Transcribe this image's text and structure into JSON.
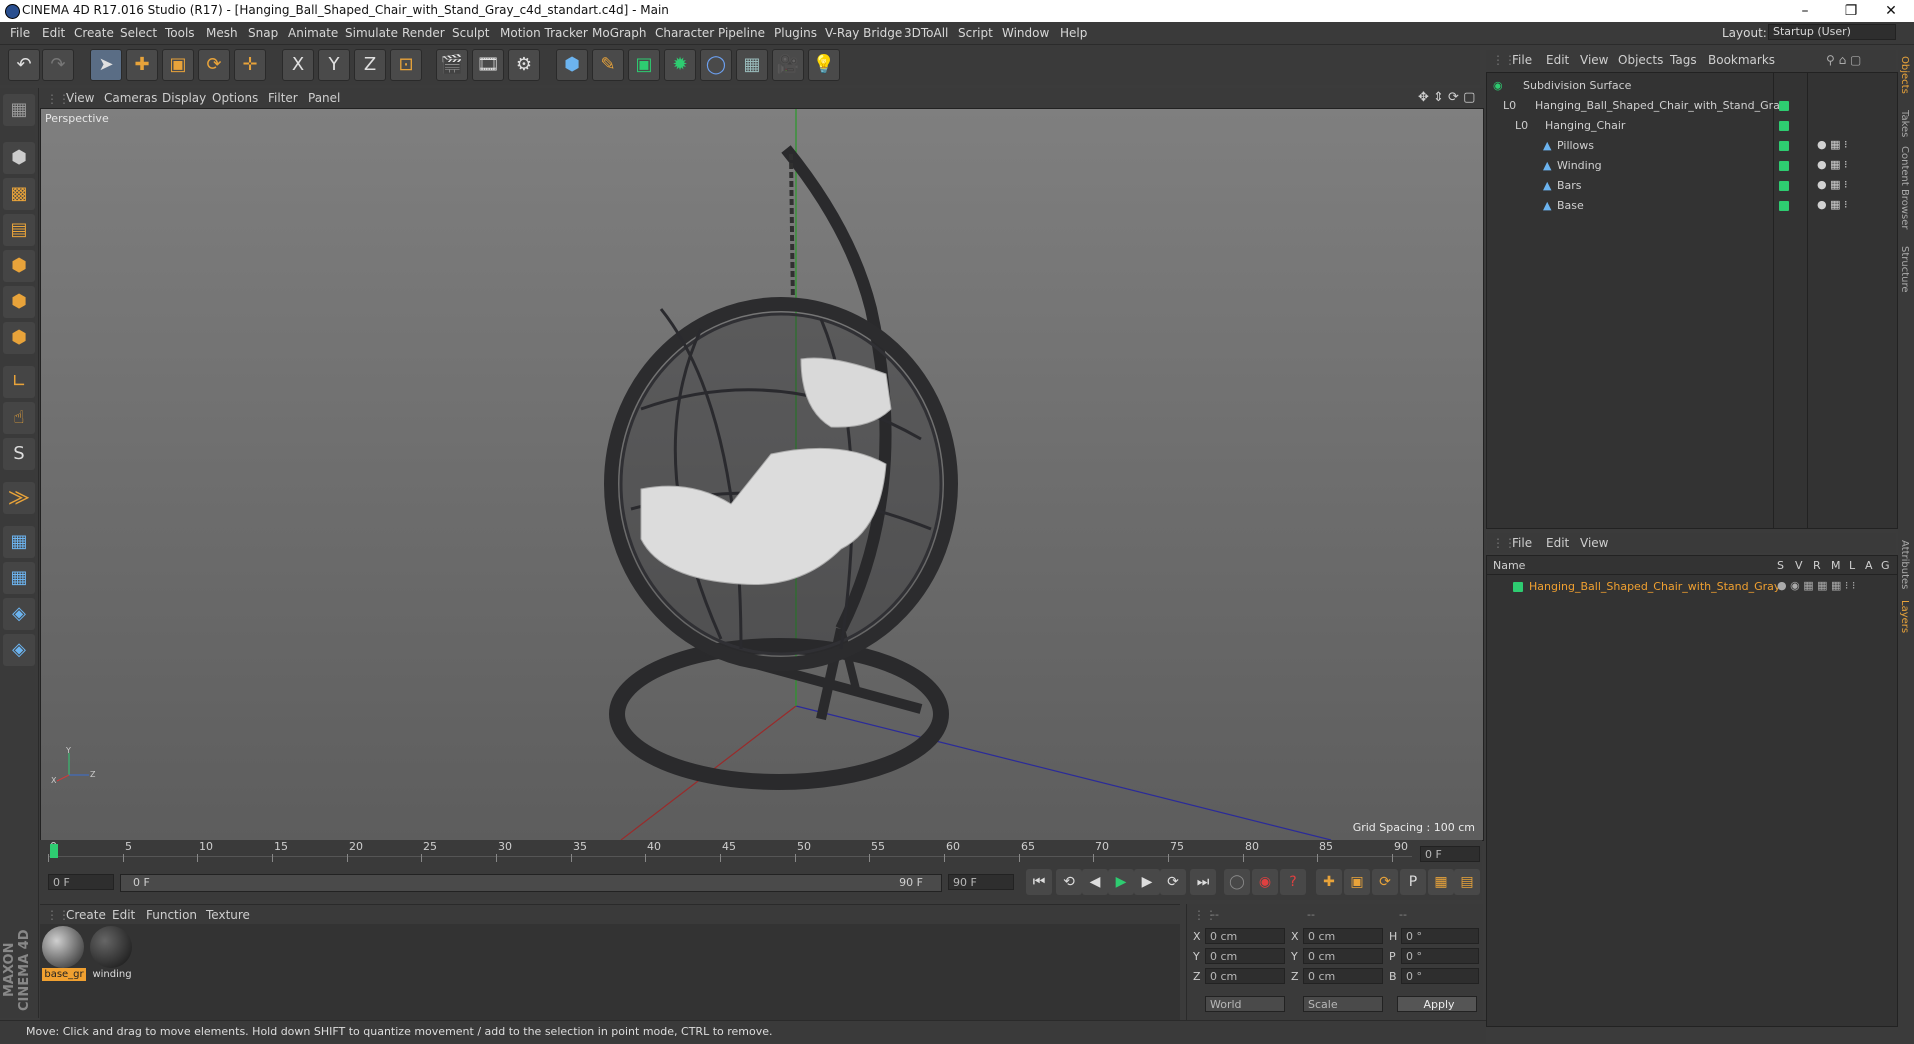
{
  "window": {
    "title": "CINEMA 4D R17.016 Studio (R17) - [Hanging_Ball_Shaped_Chair_with_Stand_Gray_c4d_standart.c4d] - Main"
  },
  "menubar": [
    "File",
    "Edit",
    "Create",
    "Select",
    "Tools",
    "Mesh",
    "Snap",
    "Animate",
    "Simulate",
    "Render",
    "Sculpt",
    "Motion Tracker",
    "MoGraph",
    "Character",
    "Pipeline",
    "Plugins",
    "V-Ray Bridge",
    "3DToAll",
    "Script",
    "Window",
    "Help"
  ],
  "layout": {
    "label": "Layout:",
    "value": "Startup (User)"
  },
  "viewport": {
    "menu": [
      "View",
      "Cameras",
      "Display",
      "Options",
      "Filter",
      "Panel"
    ],
    "label": "Perspective",
    "grid_spacing": "Grid Spacing : 100 cm"
  },
  "timeline": {
    "ticks": [
      "0",
      "5",
      "10",
      "15",
      "20",
      "25",
      "30",
      "35",
      "40",
      "45",
      "50",
      "55",
      "60",
      "65",
      "70",
      "75",
      "80",
      "85",
      "90"
    ],
    "current_frame": "0 F",
    "start": "0 F",
    "range_start": "0 F",
    "range_end": "90 F",
    "end": "90 F"
  },
  "materials": {
    "menu": [
      "Create",
      "Edit",
      "Function",
      "Texture"
    ],
    "items": [
      {
        "name": "base_gr"
      },
      {
        "name": "winding"
      }
    ]
  },
  "coords": {
    "header": [
      "--",
      "--",
      "--"
    ],
    "rows": [
      {
        "a": "X",
        "av": "0 cm",
        "b": "X",
        "bv": "0 cm",
        "c": "H",
        "cv": "0 °"
      },
      {
        "a": "Y",
        "av": "0 cm",
        "b": "Y",
        "bv": "0 cm",
        "c": "P",
        "cv": "0 °"
      },
      {
        "a": "Z",
        "av": "0 cm",
        "b": "Z",
        "bv": "0 cm",
        "c": "B",
        "cv": "0 °"
      }
    ],
    "mode": "World",
    "scale": "Scale",
    "apply": "Apply"
  },
  "objects": {
    "menu": [
      "File",
      "Edit",
      "View",
      "Objects",
      "Tags",
      "Bookmarks"
    ],
    "tree": [
      {
        "name": "Subdivision Surface",
        "level": 0
      },
      {
        "name": "Hanging_Ball_Shaped_Chair_with_Stand_Gray",
        "level": 1
      },
      {
        "name": "Hanging_Chair",
        "level": 2
      },
      {
        "name": "Pillows",
        "level": 3
      },
      {
        "name": "Winding",
        "level": 3
      },
      {
        "name": "Bars",
        "level": 3
      },
      {
        "name": "Base",
        "level": 3
      }
    ]
  },
  "layers": {
    "menu": [
      "File",
      "Edit",
      "View"
    ],
    "columns": {
      "name": "Name",
      "flags": [
        "S",
        "V",
        "R",
        "M",
        "L",
        "A",
        "G"
      ]
    },
    "rows": [
      {
        "name": "Hanging_Ball_Shaped_Chair_with_Stand_Gray"
      }
    ]
  },
  "right_tabs": [
    "Objects",
    "Takes",
    "Content Browser",
    "Structure",
    "Attributes",
    "Layers"
  ],
  "status": "Move: Click and drag to move elements. Hold down SHIFT to quantize movement / add to the selection in point mode, CTRL to remove.",
  "brand": "MAXON CINEMA 4D",
  "colors": {
    "accent": "#2ecc71",
    "selection": "#f0a030"
  }
}
